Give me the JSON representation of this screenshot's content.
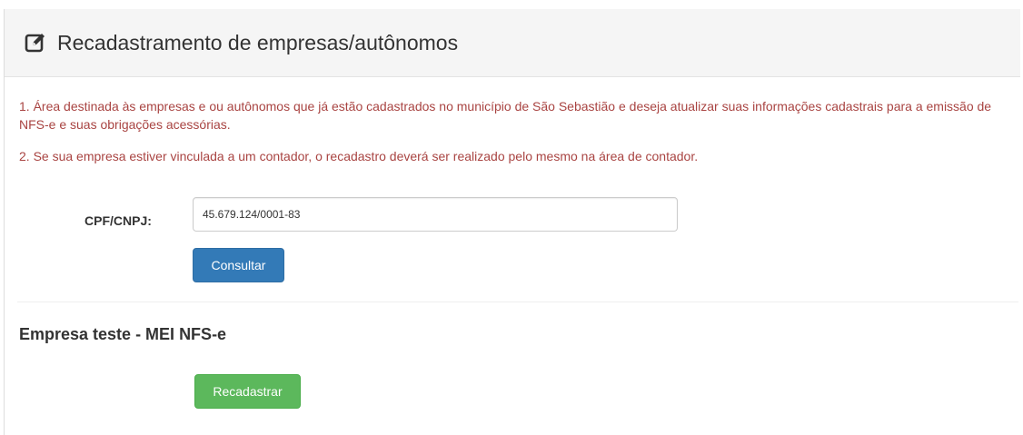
{
  "header": {
    "title": "Recadastramento de empresas/autônomos",
    "icon": "edit-icon"
  },
  "notices": [
    "1. Área destinada às empresas e ou autônomos que já estão cadastrados no município de São Sebastião e deseja atualizar suas informações cadastrais para a emissão de NFS-e e suas obrigações acessórias.",
    "2. Se sua empresa estiver vinculada a um contador, o recadastro deverá ser realizado pelo mesmo na área de contador."
  ],
  "form": {
    "cpf_label": "CPF/CNPJ:",
    "cpf_value": "45.679.124/0001-83",
    "consultar_label": "Consultar"
  },
  "result": {
    "company_name": "Empresa teste - MEI NFS-e",
    "recadastrar_label": "Recadastrar"
  },
  "colors": {
    "notice_text": "#a94442",
    "primary_button": "#337ab7",
    "success_button": "#5cb85c",
    "heading_bg": "#f5f5f5"
  }
}
